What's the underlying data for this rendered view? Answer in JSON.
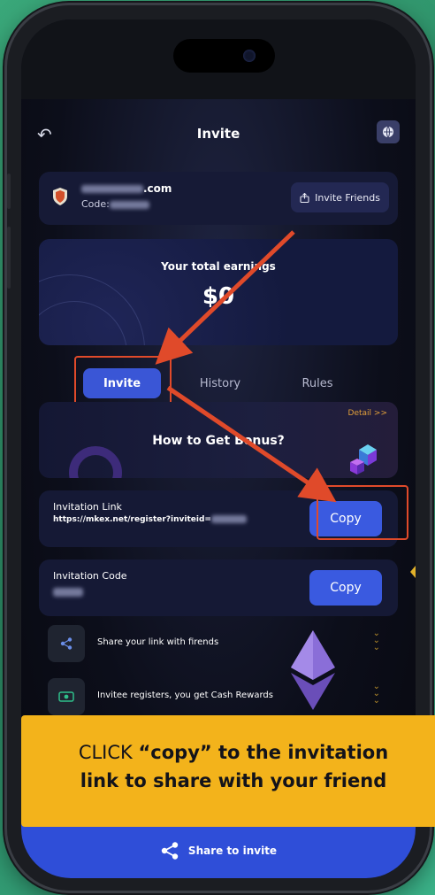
{
  "nav": {
    "title": "Invite"
  },
  "account": {
    "email_visible": ".com",
    "code_label": "Code:",
    "invite_friends_label": "Invite Friends"
  },
  "earnings": {
    "label": "Your total earnings",
    "value": "$0"
  },
  "tabs": [
    {
      "label": "Invite",
      "active": true
    },
    {
      "label": "History",
      "active": false
    },
    {
      "label": "Rules",
      "active": false
    }
  ],
  "bonus": {
    "title": "How to Get Bonus?",
    "detail": "Detail >>"
  },
  "invitation_link": {
    "label": "Invitation Link",
    "value": "https://mkex.net/register?inviteid=",
    "copy_label": "Copy"
  },
  "invitation_code": {
    "label": "Invitation Code",
    "copy_label": "Copy"
  },
  "steps": [
    {
      "icon": "share-icon",
      "text": "Share your link with firends"
    },
    {
      "icon": "cash-icon",
      "text": "Invitee registers, you get Cash Rewards"
    }
  ],
  "banner": {
    "pre": "CLICK ",
    "bold1": "“copy” to the invitation",
    "line2": "link to share with your friend"
  },
  "share": {
    "label": "Share to invite"
  },
  "colors": {
    "accent": "#3a5ae0",
    "highlight": "#e04a2a",
    "banner": "#f3b31b"
  }
}
